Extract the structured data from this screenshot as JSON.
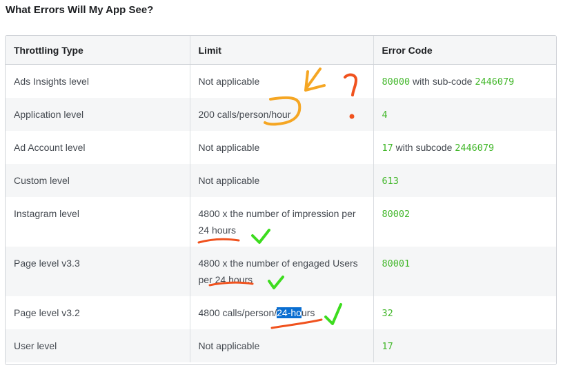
{
  "page": {
    "title": "What Errors Will My App See?"
  },
  "table": {
    "headers": [
      "Throttling Type",
      "Limit",
      "Error Code"
    ],
    "rows": [
      {
        "type": "Ads Insights level",
        "limit": "Not applicable",
        "code": "80000",
        "mid": " with sub-code ",
        "subcode": "2446079"
      },
      {
        "type": "Application level",
        "limit": "200 calls/person/hour",
        "code": "4"
      },
      {
        "type": "Ad Account level",
        "limit": "Not applicable",
        "code": "17",
        "mid": " with subcode ",
        "subcode": "2446079"
      },
      {
        "type": "Custom level",
        "limit": "Not applicable",
        "code": "613"
      },
      {
        "type": "Instagram level",
        "limit": "4800 x the number of impression per 24 hours",
        "code": "80002"
      },
      {
        "type": "Page level v3.3",
        "limit": "4800 x the number of engaged Users per 24 hours",
        "code": "80001"
      },
      {
        "type": "Page level v3.2",
        "limit_pre": "4800 calls/person/",
        "limit_sel": "24-ho",
        "limit_post": "urs",
        "code": "32"
      },
      {
        "type": "User level",
        "limit": "Not applicable",
        "code": "17"
      }
    ]
  },
  "colors": {
    "code_green": "#42b72a",
    "selection_blue": "#0a6ed1",
    "annotation_orange": "#f5a623",
    "annotation_red": "#f0521e",
    "annotation_check": "#3ddc1f"
  }
}
